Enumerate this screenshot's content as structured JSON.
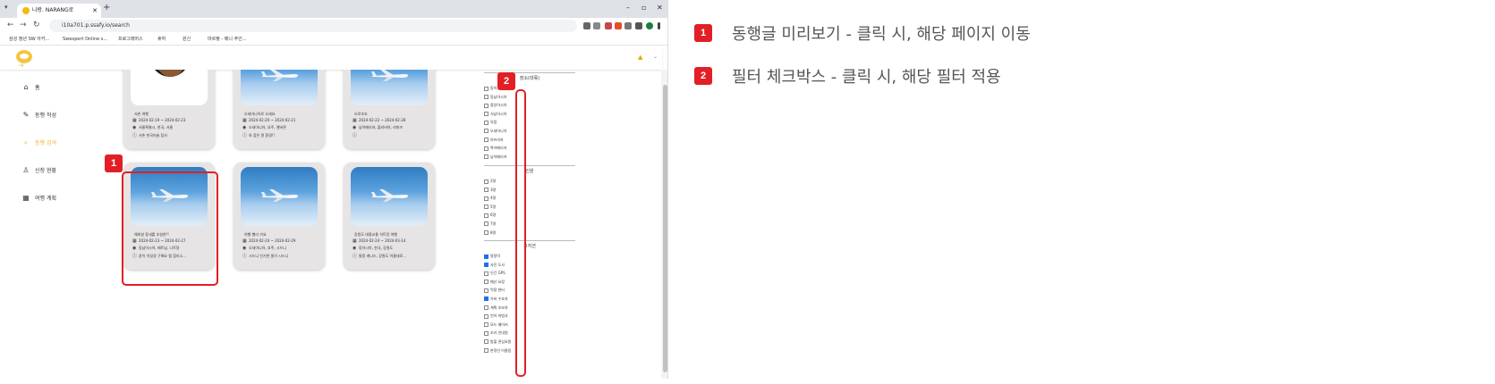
{
  "browser": {
    "tab_title": "나랑. NARANG로",
    "url": "i10a701.p.ssafy.io/search",
    "bookmarks": [
      "삼성 청년 SW 아카...",
      "Swexpert Online s...",
      "프로그래머스",
      "휴하",
      "원신",
      "마르뷜 - 메니 주인..."
    ]
  },
  "app": {
    "logo_text": "나랑",
    "sidebar": [
      {
        "icon": "home-icon",
        "glyph": "⌂",
        "label": "홈"
      },
      {
        "icon": "edit-icon",
        "glyph": "✎",
        "label": "동행 작성"
      },
      {
        "icon": "search-icon",
        "glyph": "⌕",
        "label": "동행 검색",
        "active": true
      },
      {
        "icon": "person-add-icon",
        "glyph": "♙",
        "label": "신청 현황"
      },
      {
        "icon": "calendar-icon",
        "glyph": "▦",
        "label": "여행 계획"
      }
    ],
    "cards": [
      {
        "title": "서촌 여행",
        "date": "2024-02-19 ~ 2024-02-23",
        "place": "서울특별시, 한국, 서울",
        "desc": "서촌 한국미술 탐사",
        "image": "portrait"
      },
      {
        "title": "오세아니아로 오세요",
        "date": "2024-02-20 ~ 2024-02-21",
        "place": "오세아니아, 호주, 멜버른",
        "desc": "와 잡은 뭔 환경!!",
        "image": "plane"
      },
      {
        "title": "오로조조",
        "date": "2024-02-22 ~ 2024-02-28",
        "place": "남아메리카, 볼리비아, 라파즈",
        "desc": "",
        "image": "plane"
      },
      {
        "title": "해외살 동네를 부실한!!",
        "date": "2024-02-23 ~ 2024-02-27",
        "place": "동남아시아, 베트남, 나트랑",
        "desc": "같이 이길경 구해요 랩 참리소...",
        "image": "plane"
      },
      {
        "title": "여행 빨리 가요",
        "date": "2024-02-24 ~ 2024-02-29",
        "place": "오세아니아, 호주, 시드니",
        "desc": "시드니 인기한 둘이 시드니",
        "image": "plane"
      },
      {
        "title": "강원도 대중교통 석트랑 여행",
        "date": "2024-02-24 ~ 2024-03-14",
        "place": "동아시아, 한국, 강원도",
        "desc": "통풍 캐니드, 강원도 어름대로...",
        "image": "plane"
      }
    ],
    "filters": [
      {
        "title": "장소(대륙)",
        "options": [
          {
            "label": "동아시아",
            "checked": false
          },
          {
            "label": "동남아시아",
            "checked": false
          },
          {
            "label": "중앙아시아",
            "checked": false
          },
          {
            "label": "서남아시아",
            "checked": false
          },
          {
            "label": "유럽",
            "checked": false
          },
          {
            "label": "오세아니아",
            "checked": false
          },
          {
            "label": "아프리카",
            "checked": false
          },
          {
            "label": "북아메리카",
            "checked": false
          },
          {
            "label": "남아메리카",
            "checked": false
          }
        ]
      },
      {
        "title": "인원",
        "options": [
          {
            "label": "2명",
            "checked": false
          },
          {
            "label": "3명",
            "checked": false
          },
          {
            "label": "4명",
            "checked": false
          },
          {
            "label": "5명",
            "checked": false
          },
          {
            "label": "6명",
            "checked": false
          },
          {
            "label": "7명",
            "checked": false
          },
          {
            "label": "8명",
            "checked": false
          }
        ]
      },
      {
        "title": "로지션",
        "options": [
          {
            "label": "알잘딱",
            "checked": true
          },
          {
            "label": "사진 도사",
            "checked": true
          },
          {
            "label": "인간 GPS",
            "checked": false
          },
          {
            "label": "예산 요정",
            "checked": false
          },
          {
            "label": "먹잘 헌터",
            "checked": false
          },
          {
            "label": "가비 수호자",
            "checked": true
          },
          {
            "label": "계획 조보자",
            "checked": false
          },
          {
            "label": "언어 마법사",
            "checked": false
          },
          {
            "label": "모드 메이커",
            "checked": false
          },
          {
            "label": "조카 안내원",
            "checked": false
          },
          {
            "label": "밤볼 관심요원",
            "checked": false
          },
          {
            "label": "판정인 어울림",
            "checked": false
          }
        ]
      }
    ]
  },
  "annotations": [
    {
      "num": "1",
      "text": "동행글 미리보기 - 클릭 시, 해당 페이지 이동"
    },
    {
      "num": "2",
      "text": "필터 체크박스 - 클릭 시, 해당 필터 적용"
    }
  ]
}
